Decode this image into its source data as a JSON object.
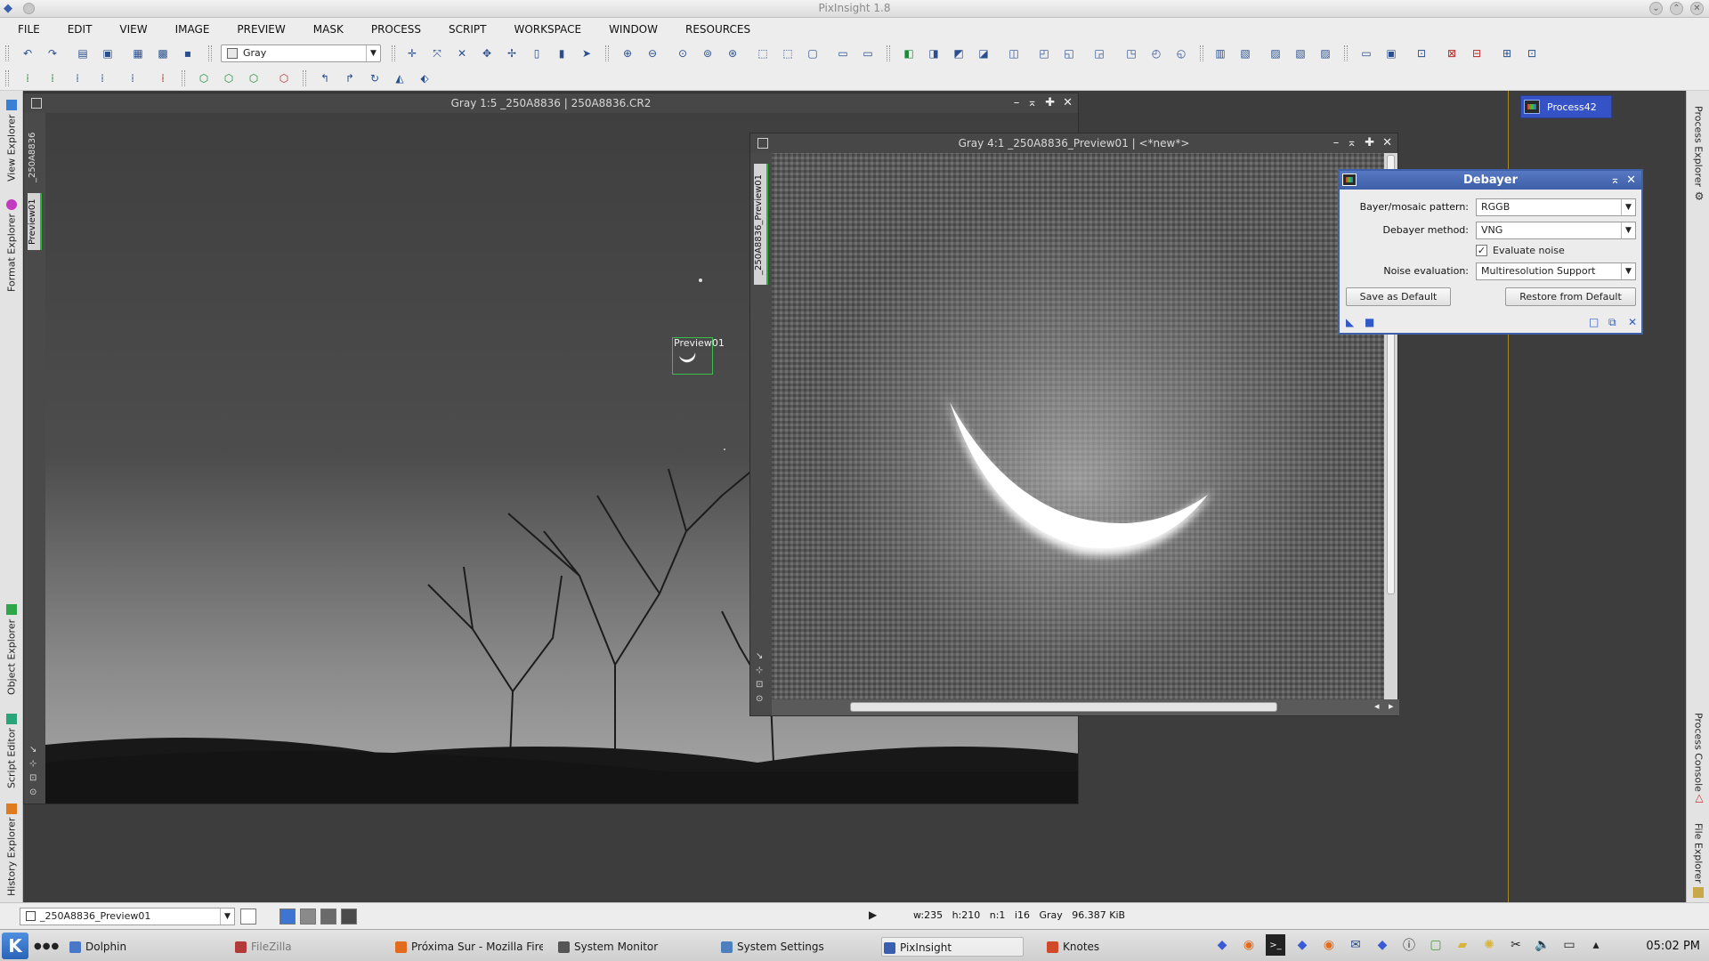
{
  "window": {
    "title": "PixInsight 1.8"
  },
  "menu": [
    "FILE",
    "EDIT",
    "VIEW",
    "IMAGE",
    "PREVIEW",
    "MASK",
    "PROCESS",
    "SCRIPT",
    "WORKSPACE",
    "WINDOW",
    "RESOURCES"
  ],
  "toolbar": {
    "colorspace": "Gray"
  },
  "left_dock": {
    "tabs": [
      "View Explorer",
      "Format Explorer",
      "Object Explorer",
      "Script Editor",
      "History Explorer"
    ]
  },
  "right_dock": {
    "tabs": [
      "Process Explorer",
      "Process Console",
      "File Explorer"
    ]
  },
  "image_window_1": {
    "title": "Gray 1:5 _250A8836 | 250A8836.CR2",
    "side_tabs": [
      "_250A8836",
      "Preview01"
    ],
    "preview_label": "Preview01"
  },
  "image_window_2": {
    "title": "Gray 4:1 _250A8836_Preview01 | <*new*>",
    "side_tab": "_250A8836_Preview01"
  },
  "process_icon": {
    "label": "Process42"
  },
  "debayer": {
    "title": "Debayer",
    "pattern_label": "Bayer/mosaic pattern:",
    "pattern_value": "RGGB",
    "method_label": "Debayer method:",
    "method_value": "VNG",
    "evaluate_noise_label": "Evaluate noise",
    "evaluate_noise_checked": true,
    "noise_eval_label": "Noise evaluation:",
    "noise_eval_value": "Multiresolution Support",
    "save_default": "Save as Default",
    "restore_default": "Restore from Default"
  },
  "statusbar": {
    "view": "_250A8836_Preview01",
    "info": "w:235   h:210   n:1   i16   Gray   96.387 KiB"
  },
  "taskbar": {
    "tasks": [
      {
        "label": "Dolphin",
        "color": "#4a78c8"
      },
      {
        "label": "FileZilla",
        "color": "#b33a3a",
        "dim": true
      },
      {
        "label": "Próxima Sur - Mozilla Firef",
        "color": "#e36b1e"
      },
      {
        "label": "System Monitor",
        "color": "#555555"
      },
      {
        "label": "System Settings",
        "color": "#4d7fbf"
      },
      {
        "label": "PixInsight",
        "color": "#3a5fb0",
        "active": true
      },
      {
        "label": "Knotes",
        "color": "#d04a2a"
      }
    ],
    "clock": "05:02 PM"
  },
  "colors": {
    "debayer_title": "#3e60a8",
    "preview_outline": "#3bbf4c",
    "process_icon": "#3553c7"
  }
}
